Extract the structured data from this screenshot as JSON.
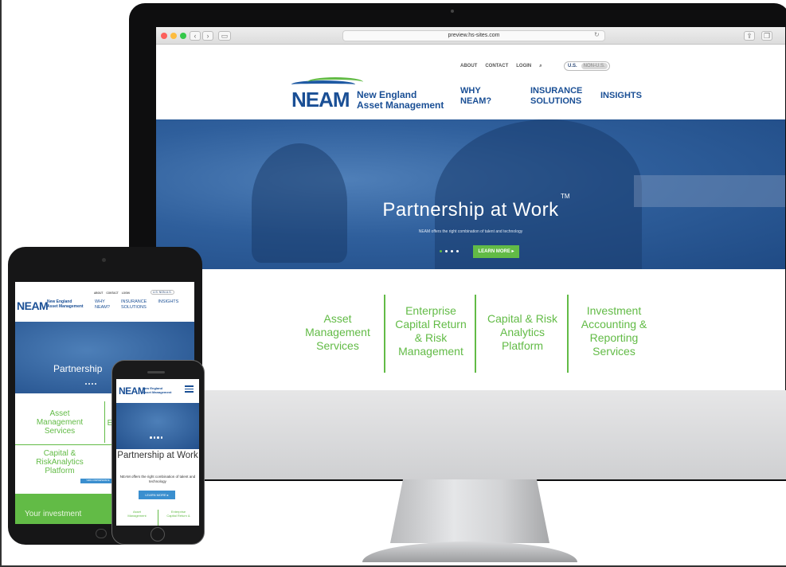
{
  "browser": {
    "url": "preview.hs-sites.com",
    "back_icon": "‹",
    "forward_icon": "›",
    "reload_icon": "↻"
  },
  "header": {
    "top_links": [
      "ABOUT",
      "CONTACT",
      "LOGIN"
    ],
    "region": {
      "us": "U.S.",
      "non_us": "NON-U.S."
    },
    "logo": {
      "mark": "NEAM",
      "line1": "New England",
      "line2": "Asset Management"
    },
    "nav": [
      {
        "line1": "WHY",
        "line2": "NEAM?"
      },
      {
        "line1": "INSURANCE",
        "line2": "SOLUTIONS"
      },
      {
        "line1": "INSIGHTS",
        "line2": ""
      }
    ]
  },
  "hero": {
    "title": "Partnership at Work",
    "tm": "TM",
    "subtitle": "NEAM offers the right combination of talent and technology",
    "cta": "LEARN MORE ▸",
    "slide_count": 4,
    "active_slide": 1
  },
  "services": [
    {
      "lines": [
        "Asset",
        "Management",
        "Services"
      ]
    },
    {
      "lines": [
        "Enterprise",
        "Capital Return",
        "& Risk",
        "Management"
      ]
    },
    {
      "lines": [
        "Capital & Risk",
        "Analytics",
        "Platform"
      ]
    },
    {
      "lines": [
        "Investment",
        "Accounting &",
        "Reporting",
        "Services"
      ]
    }
  ],
  "tablet": {
    "top_links": [
      "ABOUT",
      "CONTACT",
      "LOGIN"
    ],
    "region": "U.S.  NON-U.S.",
    "nav": [
      "WHY\nNEAM?",
      "INSURANCE\nSOLUTIONS",
      "INSIGHTS"
    ],
    "hero_title": "Partnership",
    "service_1": [
      "Asset",
      "Management",
      "Services"
    ],
    "service_2_partial": "E",
    "service_3": [
      "Capital &",
      "RiskAnalytics",
      "Platform"
    ],
    "cta": "VIEW COMPREHENSIVE SOLUTIONS",
    "green_text": "Your investment"
  },
  "phone": {
    "hero_title": "Partnership at Work",
    "subtitle": "NEAM offers the right combination of talent and technology",
    "cta": "LEARN MORE ▸",
    "service_left": [
      "Asset",
      "Management"
    ],
    "service_right": [
      "Enterprise",
      "Capital Return &"
    ]
  },
  "colors": {
    "brand_blue": "#1a4f95",
    "brand_green": "#62bb46"
  }
}
